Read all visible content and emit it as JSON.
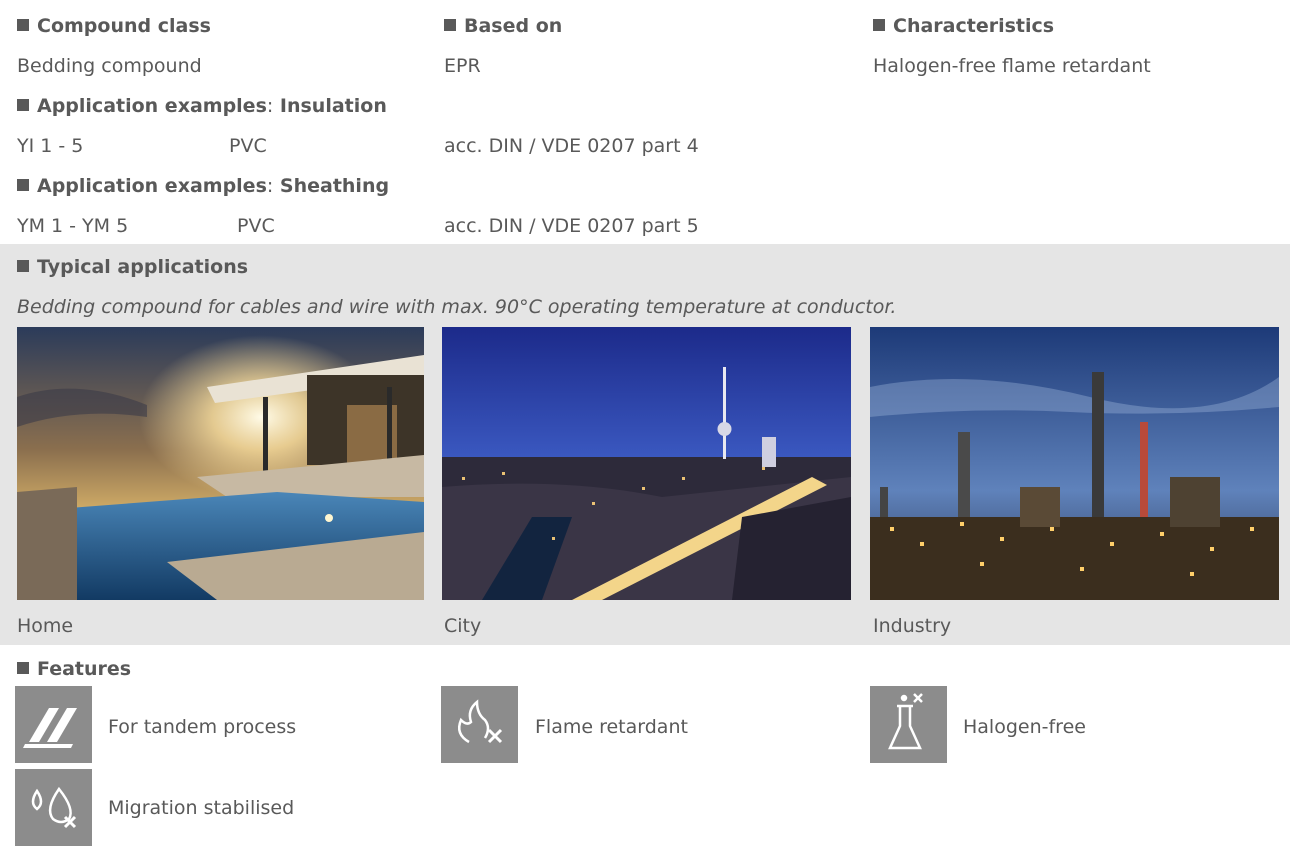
{
  "header": {
    "compound_class_label": "Compound class",
    "based_on_label": "Based on",
    "characteristics_label": "Characteristics",
    "compound_class_value": "Bedding compound",
    "based_on_value": "EPR",
    "characteristics_value": "Halogen-free flame retardant"
  },
  "insulation": {
    "label_prefix": "Application examples",
    "label_colon": ":",
    "label_suffix": "Insulation",
    "type": "YI 1 - 5",
    "material": "PVC",
    "standard": "acc. DIN / VDE 0207 part 4"
  },
  "sheathing": {
    "label_prefix": "Application examples",
    "label_colon": ":",
    "label_suffix": "Sheathing",
    "type": "YM 1 - YM 5",
    "material": "PVC",
    "standard": "acc. DIN / VDE 0207 part 5"
  },
  "typical": {
    "label": "Typical applications",
    "description": "Bedding compound for cables and wire with max. 90°C operating temperature at conductor.",
    "images": [
      {
        "caption": "Home",
        "icon": "home-photo"
      },
      {
        "caption": "City",
        "icon": "city-photo"
      },
      {
        "caption": "Industry",
        "icon": "industry-photo"
      }
    ]
  },
  "features": {
    "label": "Features",
    "items": [
      {
        "label": "For tandem process",
        "icon": "tandem-process-icon"
      },
      {
        "label": "Flame retardant",
        "icon": "flame-retardant-icon"
      },
      {
        "label": "Halogen-free",
        "icon": "halogen-free-icon"
      },
      {
        "label": "Migration stabilised",
        "icon": "migration-stabilised-icon"
      }
    ]
  },
  "colors": {
    "text": "#595959",
    "band": "#e5e5e5",
    "icon_bg": "#8c8c8c"
  }
}
